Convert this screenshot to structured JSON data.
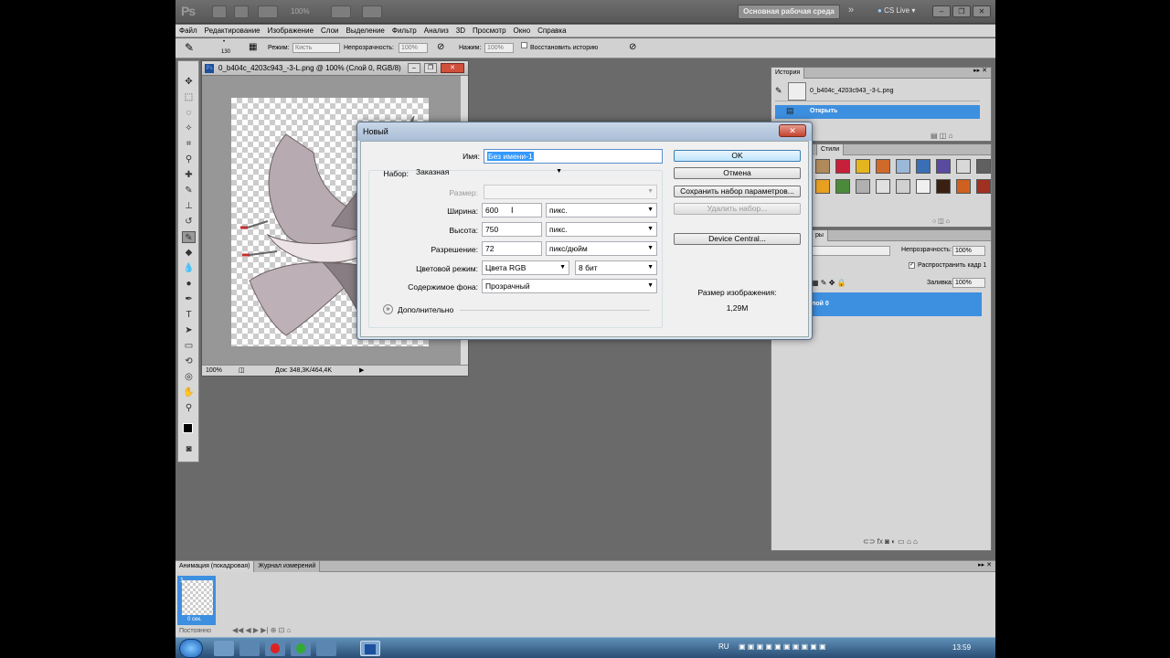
{
  "app": {
    "logo": "Ps",
    "zoom": "100%",
    "workspace_label": "Основная рабочая среда",
    "cs_live": "CS Live"
  },
  "menu": [
    "Файл",
    "Редактирование",
    "Изображение",
    "Слои",
    "Выделение",
    "Фильтр",
    "Анализ",
    "3D",
    "Просмотр",
    "Окно",
    "Справка"
  ],
  "options": {
    "brush_size": "130",
    "mode_label": "Режим:",
    "mode_value": "Кисть",
    "opacity_label": "Непрозрачность:",
    "opacity_value": "100%",
    "press_label": "Нажим:",
    "press_value": "100%",
    "restore_history": "Восстановить историю"
  },
  "document": {
    "title": "0_b404c_4203c943_-3-L.png @ 100% (Слой 0, RGB/8)",
    "zoom": "100%",
    "doc_info": "Док: 348,3K/464,4K"
  },
  "history_panel": {
    "tab": "История",
    "snapshot": "0_b404c_4203c943_-3-L.png",
    "step": "Открыть"
  },
  "styles_panel": {
    "tab_partial": "цы",
    "tab_active": "Стили",
    "swatches": [
      "#b08a5a",
      "#c8203a",
      "#e5b520",
      "#d06a2a",
      "#9ab8d8",
      "#3a6fb5",
      "#5a4aa0",
      "#d8d8d8",
      "#606060",
      "#e8c030",
      "#d89020",
      "#e8a020",
      "#4a8a3a",
      "#b0b0b0",
      "#e0e0e0",
      "#d0d0d0",
      "#f0f0f0",
      "#3a2010",
      "#d06020",
      "#a03020",
      "#e8d040",
      "#202020"
    ]
  },
  "layers_panel": {
    "tab_partial": "ры",
    "opacity_label": "Непрозрачность:",
    "opacity_value": "100%",
    "propagate": "Распространить кадр 1",
    "fill_label": "Заливка:",
    "fill_value": "100%",
    "layer_name": "лой 0"
  },
  "dialog": {
    "title": "Новый",
    "name_label": "Имя:",
    "name_value": "Без имени-1",
    "preset_label": "Набор:",
    "preset_value": "Заказная",
    "size_label": "Размер:",
    "width_label": "Ширина:",
    "width_value": "600",
    "width_unit": "пикс.",
    "height_label": "Высота:",
    "height_value": "750",
    "height_unit": "пикс.",
    "resolution_label": "Разрешение:",
    "resolution_value": "72",
    "resolution_unit": "пикс/дюйм",
    "color_mode_label": "Цветовой режим:",
    "color_mode_value": "Цвета RGB",
    "bit_depth": "8 бит",
    "background_label": "Содержимое фона:",
    "background_value": "Прозрачный",
    "advanced": "Дополнительно",
    "ok": "OK",
    "cancel": "Отмена",
    "save_preset": "Сохранить набор параметров...",
    "delete_preset": "Удалить набор...",
    "device_central": "Device Central...",
    "image_size_label": "Размер изображения:",
    "image_size_value": "1,29M"
  },
  "animation_panel": {
    "tab_active": "Анимация (покадровая)",
    "tab_other": "Журнал измерений",
    "frame_number": "1",
    "frame_delay": "0 сек.",
    "loop": "Постоянно"
  },
  "taskbar": {
    "lang": "RU",
    "time": "13:59"
  }
}
